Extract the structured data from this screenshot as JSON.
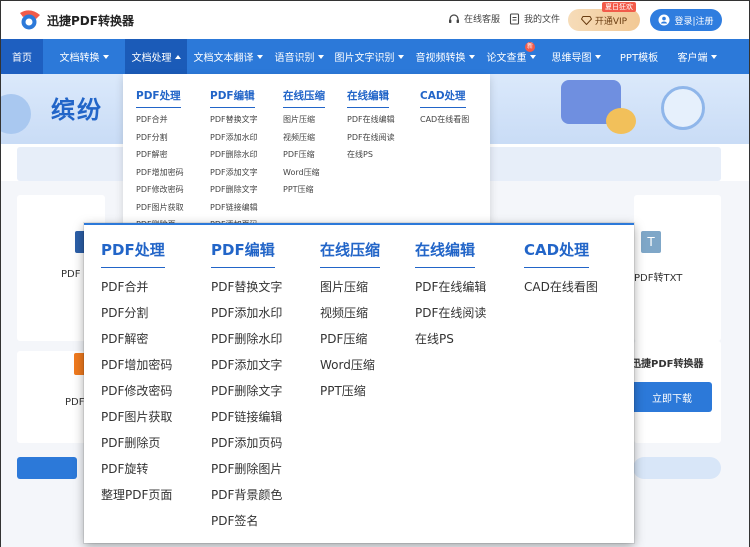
{
  "header": {
    "app_name": "迅捷PDF转换器",
    "service_label": "在线客服",
    "files_label": "我的文件",
    "vip_tag": "夏日狂欢",
    "vip_label": "开通VIP",
    "login_label": "登录|注册"
  },
  "nav": {
    "items": [
      {
        "label": "首页",
        "dropdown": false
      },
      {
        "label": "文档转换",
        "dropdown": true
      },
      {
        "label": "文档处理",
        "dropdown": true
      },
      {
        "label": "文档文本翻译",
        "dropdown": true
      },
      {
        "label": "语音识别",
        "dropdown": true
      },
      {
        "label": "图片文字识别",
        "dropdown": true
      },
      {
        "label": "音视频转换",
        "dropdown": true
      },
      {
        "label": "论文查重",
        "dropdown": true,
        "badge": "新"
      },
      {
        "label": "思维导图",
        "dropdown": true
      },
      {
        "label": "PPT模板",
        "dropdown": false
      },
      {
        "label": "客户端",
        "dropdown": true
      }
    ]
  },
  "background": {
    "banner_title": "缤纷",
    "card_left_1": "PDF",
    "card_right_1": "PDF转TXT",
    "card_right_1_icon": "T",
    "card_left_2": "PDF",
    "promo_title": "迅捷PDF转换器",
    "download_label": "立即下载"
  },
  "menu": {
    "columns": [
      {
        "title": "PDF处理",
        "items": [
          "PDF合并",
          "PDF分割",
          "PDF解密",
          "PDF增加密码",
          "PDF修改密码",
          "PDF图片获取",
          "PDF删除页",
          "PDF旋转",
          "整理PDF页面"
        ]
      },
      {
        "title": "PDF编辑",
        "items": [
          "PDF替换文字",
          "PDF添加水印",
          "PDF删除水印",
          "PDF添加文字",
          "PDF删除文字",
          "PDF链接编辑",
          "PDF添加页码",
          "PDF删除图片",
          "PDF背景颜色",
          "PDF签名"
        ]
      },
      {
        "title": "在线压缩",
        "items": [
          "图片压缩",
          "视频压缩",
          "PDF压缩",
          "Word压缩",
          "PPT压缩"
        ]
      },
      {
        "title": "在线编辑",
        "items": [
          "PDF在线编辑",
          "PDF在线阅读",
          "在线PS"
        ]
      },
      {
        "title": "CAD处理",
        "items": [
          "CAD在线看图"
        ]
      }
    ]
  },
  "colors": {
    "nav_bg": "#2c79d9",
    "accent": "#2265c8",
    "vip_bg": "#f2c894",
    "badge": "#f25b4a"
  }
}
